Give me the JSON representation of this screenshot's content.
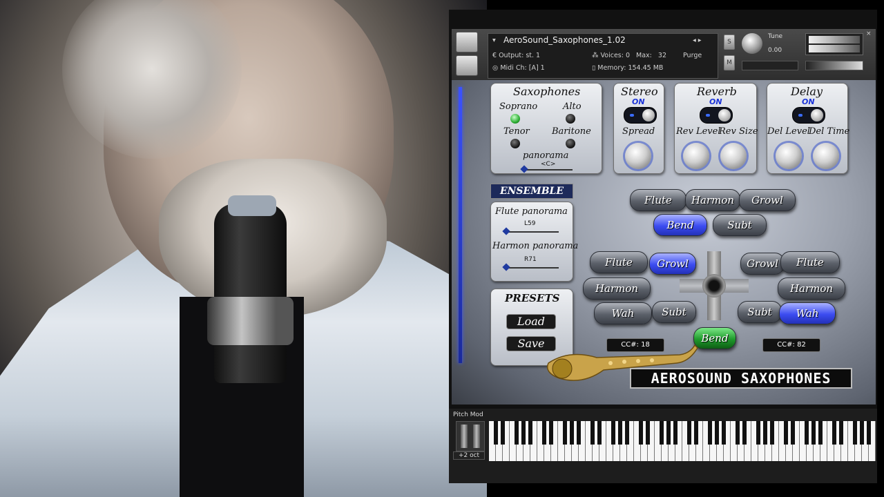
{
  "instrument": {
    "title": "AeroSound_Saxophones_1.02",
    "output_label": "Output:",
    "output_value": "st. 1",
    "voices_label": "Voices:",
    "voices_value": "0",
    "max_label": "Max:",
    "max_value": "32",
    "purge_label": "Purge",
    "midi_label": "Midi Ch:",
    "midi_value": "[A] 1",
    "memory_label": "Memory:",
    "memory_value": "154.45 MB",
    "s_label": "S",
    "m_label": "M",
    "tune_label": "Tune",
    "tune_value": "0.00"
  },
  "saxophones": {
    "title": "Saxophones",
    "soprano": "Soprano",
    "alto": "Alto",
    "tenor": "Tenor",
    "baritone": "Baritone",
    "selected": "Soprano",
    "panorama_label": "panorama",
    "panorama_value": "<C>"
  },
  "stereo": {
    "title": "Stereo",
    "state": "ON",
    "spread": "Spread"
  },
  "reverb": {
    "title": "Reverb",
    "state": "ON",
    "level": "Rev Level",
    "size": "Rev Size"
  },
  "delay": {
    "title": "Delay",
    "state": "ON",
    "level": "Del Level",
    "time": "Del Time"
  },
  "ensemble": {
    "title": "ENSEMBLE",
    "flute_label": "Flute panorama",
    "flute_value": "L59",
    "harmon_label": "Harmon panorama",
    "harmon_value": "R71"
  },
  "presets": {
    "title": "PRESETS",
    "load": "Load",
    "save": "Save"
  },
  "pads": {
    "top": {
      "flute": "Flute",
      "harmon": "Harmon",
      "growl": "Growl",
      "bend": "Bend",
      "subt": "Subt"
    },
    "left": {
      "flute": "Flute",
      "growl": "Growl",
      "harmon": "Harmon",
      "wah": "Wah",
      "subt": "Subt"
    },
    "right": {
      "growl": "Growl",
      "flute": "Flute",
      "harmon": "Harmon",
      "subt": "Subt",
      "wah": "Wah"
    },
    "bottom_bend": "Bend",
    "active": [
      "top.bend",
      "left.growl",
      "right.wah",
      "bottom_bend"
    ]
  },
  "cc_left": "CC#:   18",
  "cc_right": "CC#:   82",
  "logo": "AEROSOUND SAXOPHONES",
  "keyboard": {
    "pitch_mod": "Pitch Mod",
    "octave": "+2 oct"
  },
  "colors": {
    "accent_blue": "#3b4cf0",
    "active_green": "#1f9a2c"
  }
}
